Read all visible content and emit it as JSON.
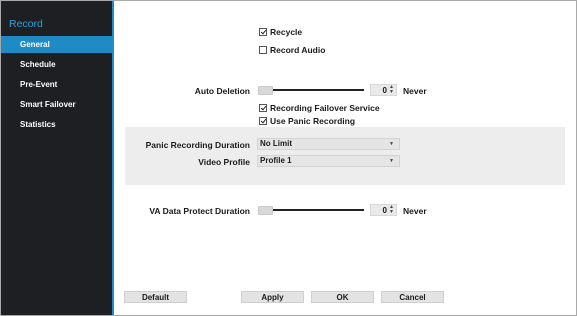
{
  "sidebar": {
    "title": "Record",
    "items": [
      {
        "label": "General",
        "active": true
      },
      {
        "label": "Schedule"
      },
      {
        "label": "Pre-Event"
      },
      {
        "label": "Smart Failover"
      },
      {
        "label": "Statistics"
      }
    ]
  },
  "general": {
    "recycle": {
      "label": "Recycle",
      "checked": true
    },
    "record_audio": {
      "label": "Record Audio",
      "checked": false
    },
    "auto_deletion": {
      "label": "Auto Deletion",
      "value": "0",
      "suffix": "Never"
    },
    "recording_failover": {
      "label": "Recording Failover Service",
      "checked": true
    },
    "use_panic": {
      "label": "Use Panic Recording",
      "checked": true
    },
    "panic_duration": {
      "label": "Panic Recording Duration",
      "selected": "No Limit"
    },
    "video_profile": {
      "label": "Video Profile",
      "selected": "Profile 1"
    },
    "va_protect": {
      "label": "VA Data Protect Duration",
      "value": "0",
      "suffix": "Never"
    }
  },
  "buttons": {
    "default": "Default",
    "apply": "Apply",
    "ok": "OK",
    "cancel": "Cancel"
  },
  "colors": {
    "sidebar_bg": "#1d1f22",
    "accent": "#1f8bc4",
    "title": "#2ba0dc"
  },
  "icons": {
    "checkbox_checked": "check-icon",
    "spinner": "spinner-arrows-icon",
    "dropdown": "dropdown-arrow-icon"
  }
}
